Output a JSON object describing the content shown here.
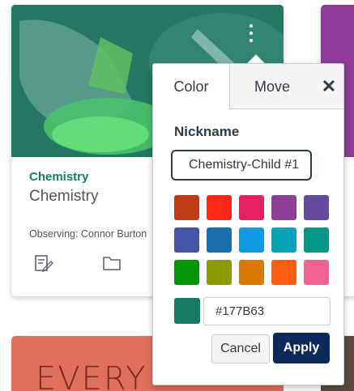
{
  "card": {
    "code": "Chemistry",
    "name": "Chemistry",
    "observing": "Observing: Connor Burton",
    "icons": [
      "assignments-icon",
      "files-icon"
    ]
  },
  "bottom_card": {
    "hero_text": "EVERY"
  },
  "popover": {
    "tabs": {
      "color": "Color",
      "move": "Move",
      "close": "✕"
    },
    "nickname_label": "Nickname",
    "nickname_value": "Chemistry-Child #1",
    "colors": [
      "#BD3C14",
      "#FF2717",
      "#E71F63",
      "#8F3E97",
      "#65499D",
      "#4554A4",
      "#1770AB",
      "#0B9BE3",
      "#06A3B7",
      "#009688",
      "#009606",
      "#8D9900",
      "#D97900",
      "#FD5D10",
      "#F06291"
    ],
    "current_color": "#177B63",
    "hex_value": "#177B63",
    "cancel_label": "Cancel",
    "apply_label": "Apply"
  }
}
